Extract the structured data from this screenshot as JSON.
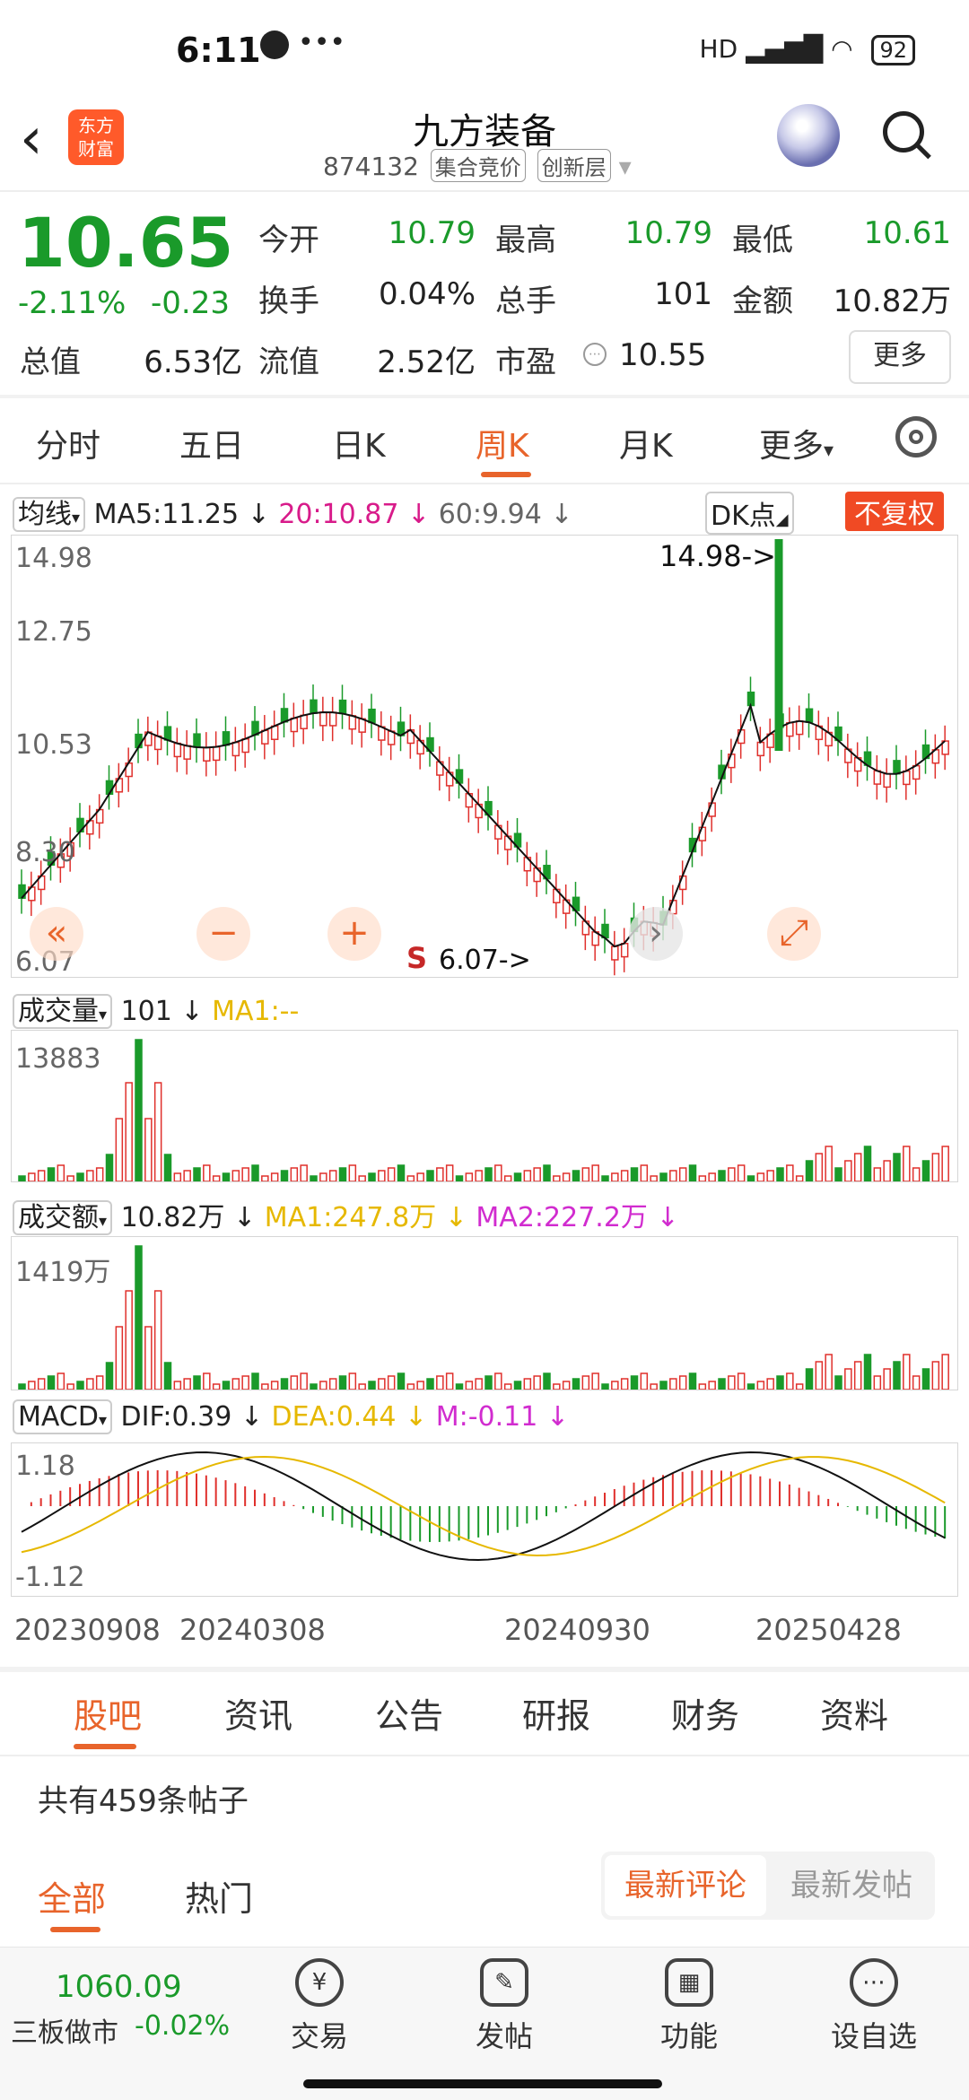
{
  "status": {
    "time": "6:11",
    "network": "HD",
    "battery": "92"
  },
  "header": {
    "title": "九方装备",
    "code": "874132",
    "tag1": "集合竞价",
    "tag2": "创新层",
    "logo_line1": "东方",
    "logo_line2": "财富"
  },
  "quote": {
    "price": "10.65",
    "pct": "-2.11%",
    "chg": "-0.23",
    "rows": [
      [
        {
          "label": "今开",
          "value": "10.79",
          "color": "green"
        },
        {
          "label": "最高",
          "value": "10.79",
          "color": "green"
        },
        {
          "label": "最低",
          "value": "10.61",
          "color": "green"
        }
      ],
      [
        {
          "label": "换手",
          "value": "0.04%",
          "color": "dark"
        },
        {
          "label": "总手",
          "value": "101",
          "color": "dark"
        },
        {
          "label": "金额",
          "value": "10.82万",
          "color": "dark"
        }
      ],
      [
        {
          "label": "总值",
          "value": "6.53亿",
          "color": "dark"
        },
        {
          "label": "流值",
          "value": "2.52亿",
          "color": "dark"
        },
        {
          "label": "市盈",
          "value": "10.55",
          "color": "dark"
        }
      ]
    ],
    "more": "更多"
  },
  "tabs": [
    "分时",
    "五日",
    "日K",
    "周K",
    "月K",
    "更多"
  ],
  "kchart": {
    "ma_selector": "均线",
    "ma5": "MA5:11.25 ↓",
    "ma20": "20:10.87 ↓",
    "ma60": "60:9.94 ↓",
    "dk": "DK点",
    "fq": "不复权",
    "y_labels": [
      "14.98",
      "12.75",
      "10.53",
      "8.30",
      "6.07"
    ],
    "max_marker": "14.98->",
    "min_marker": "6.07->",
    "s_marker": "S",
    "seq_labels": [
      "9",
      "9",
      "9",
      "8",
      "5",
      "6",
      "7",
      "1",
      "2",
      "3",
      "4",
      "4",
      "5",
      "1",
      "2",
      "3",
      "4",
      "5",
      "6",
      "7",
      "8",
      "1",
      "2",
      "3",
      "4",
      "5",
      "6",
      "7",
      "8",
      "9",
      "1",
      "2",
      "3",
      "4",
      "5",
      "6",
      "7",
      "8"
    ]
  },
  "volume": {
    "selector": "成交量",
    "value": "101 ↓",
    "ma1": "MA1:--",
    "max": "13883"
  },
  "amount": {
    "selector": "成交额",
    "value": "10.82万 ↓",
    "ma1": "MA1:247.8万 ↓",
    "ma2": "MA2:227.2万 ↓",
    "max": "1419万"
  },
  "macd": {
    "selector": "MACD",
    "dif": "DIF:0.39 ↓",
    "dea": "DEA:0.44 ↓",
    "m": "M:-0.11 ↓",
    "max": "1.18",
    "min": "-1.12"
  },
  "x_dates": [
    "20230908",
    "20240308",
    "20240930",
    "20250428"
  ],
  "chart_data": {
    "type": "candlestick",
    "title": "",
    "x_ticks": [
      "20230908",
      "20240308",
      "20240930",
      "20250428"
    ],
    "ylim": [
      6.07,
      14.98
    ],
    "ma": {
      "MA5": 11.25,
      "MA20": 10.87,
      "MA60": 9.94
    },
    "volume_max": 13883,
    "amount_max_wan": 1419,
    "macd": {
      "DIF": 0.39,
      "DEA": 0.44,
      "M": -0.11,
      "range": [
        -1.12,
        1.18
      ]
    }
  },
  "bottom_tabs": [
    "股吧",
    "资讯",
    "公告",
    "研报",
    "财务",
    "资料"
  ],
  "posts": {
    "count_text": "共有459条帖子",
    "tab_all": "全部",
    "tab_hot": "热门",
    "sort_latest_comment": "最新评论",
    "sort_latest_post": "最新发帖"
  },
  "nav": {
    "index_value": "1060.09",
    "index_name": "三板做市",
    "index_chg": "-0.02%",
    "items": [
      "交易",
      "发帖",
      "功能",
      "设自选"
    ]
  }
}
